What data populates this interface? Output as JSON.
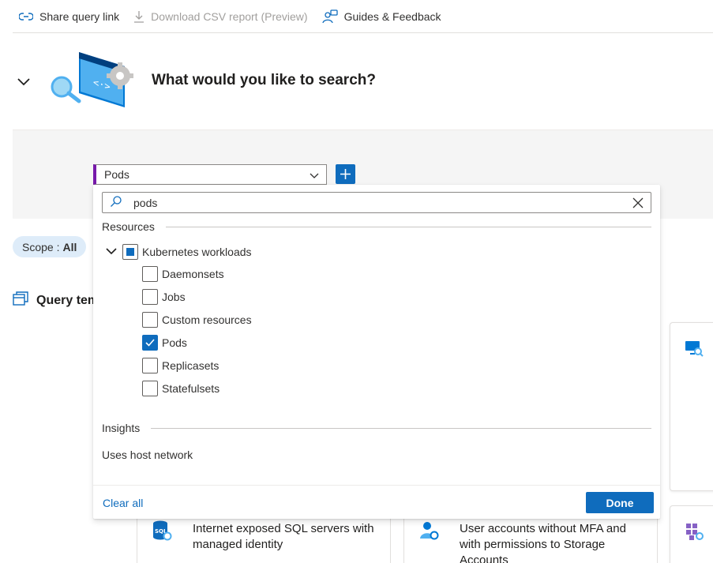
{
  "toolbar": {
    "share_label": "Share query link",
    "download_label": "Download CSV report (Preview)",
    "guides_label": "Guides & Feedback"
  },
  "header": {
    "title": "What would you like to search?"
  },
  "search": {
    "type_value": "Pods",
    "filter_value": "pods"
  },
  "scope": {
    "label": "Scope :",
    "value": "All"
  },
  "query_templates": {
    "heading": "Query templates"
  },
  "dropdown": {
    "resources_header": "Resources",
    "group_label": "Kubernetes workloads",
    "items": [
      {
        "label": "Daemonsets",
        "checked": false
      },
      {
        "label": "Jobs",
        "checked": false
      },
      {
        "label": "Custom resources",
        "checked": false
      },
      {
        "label": "Pods",
        "checked": true
      },
      {
        "label": "Replicasets",
        "checked": false
      },
      {
        "label": "Statefulsets",
        "checked": false
      }
    ],
    "insights_header": "Insights",
    "insight_item": "Uses host network",
    "clear_all_label": "Clear all",
    "done_label": "Done"
  },
  "cards": [
    {
      "icon": "sql-server-icon",
      "title": "Internet exposed SQL servers with managed identity"
    },
    {
      "icon": "user-accounts-icon",
      "title": "User accounts without MFA and with permissions to Storage Accounts"
    }
  ],
  "colors": {
    "accent": "#0f6cbd",
    "type_marker": "#7719aa",
    "scope_pill_bg": "#deecf9"
  }
}
